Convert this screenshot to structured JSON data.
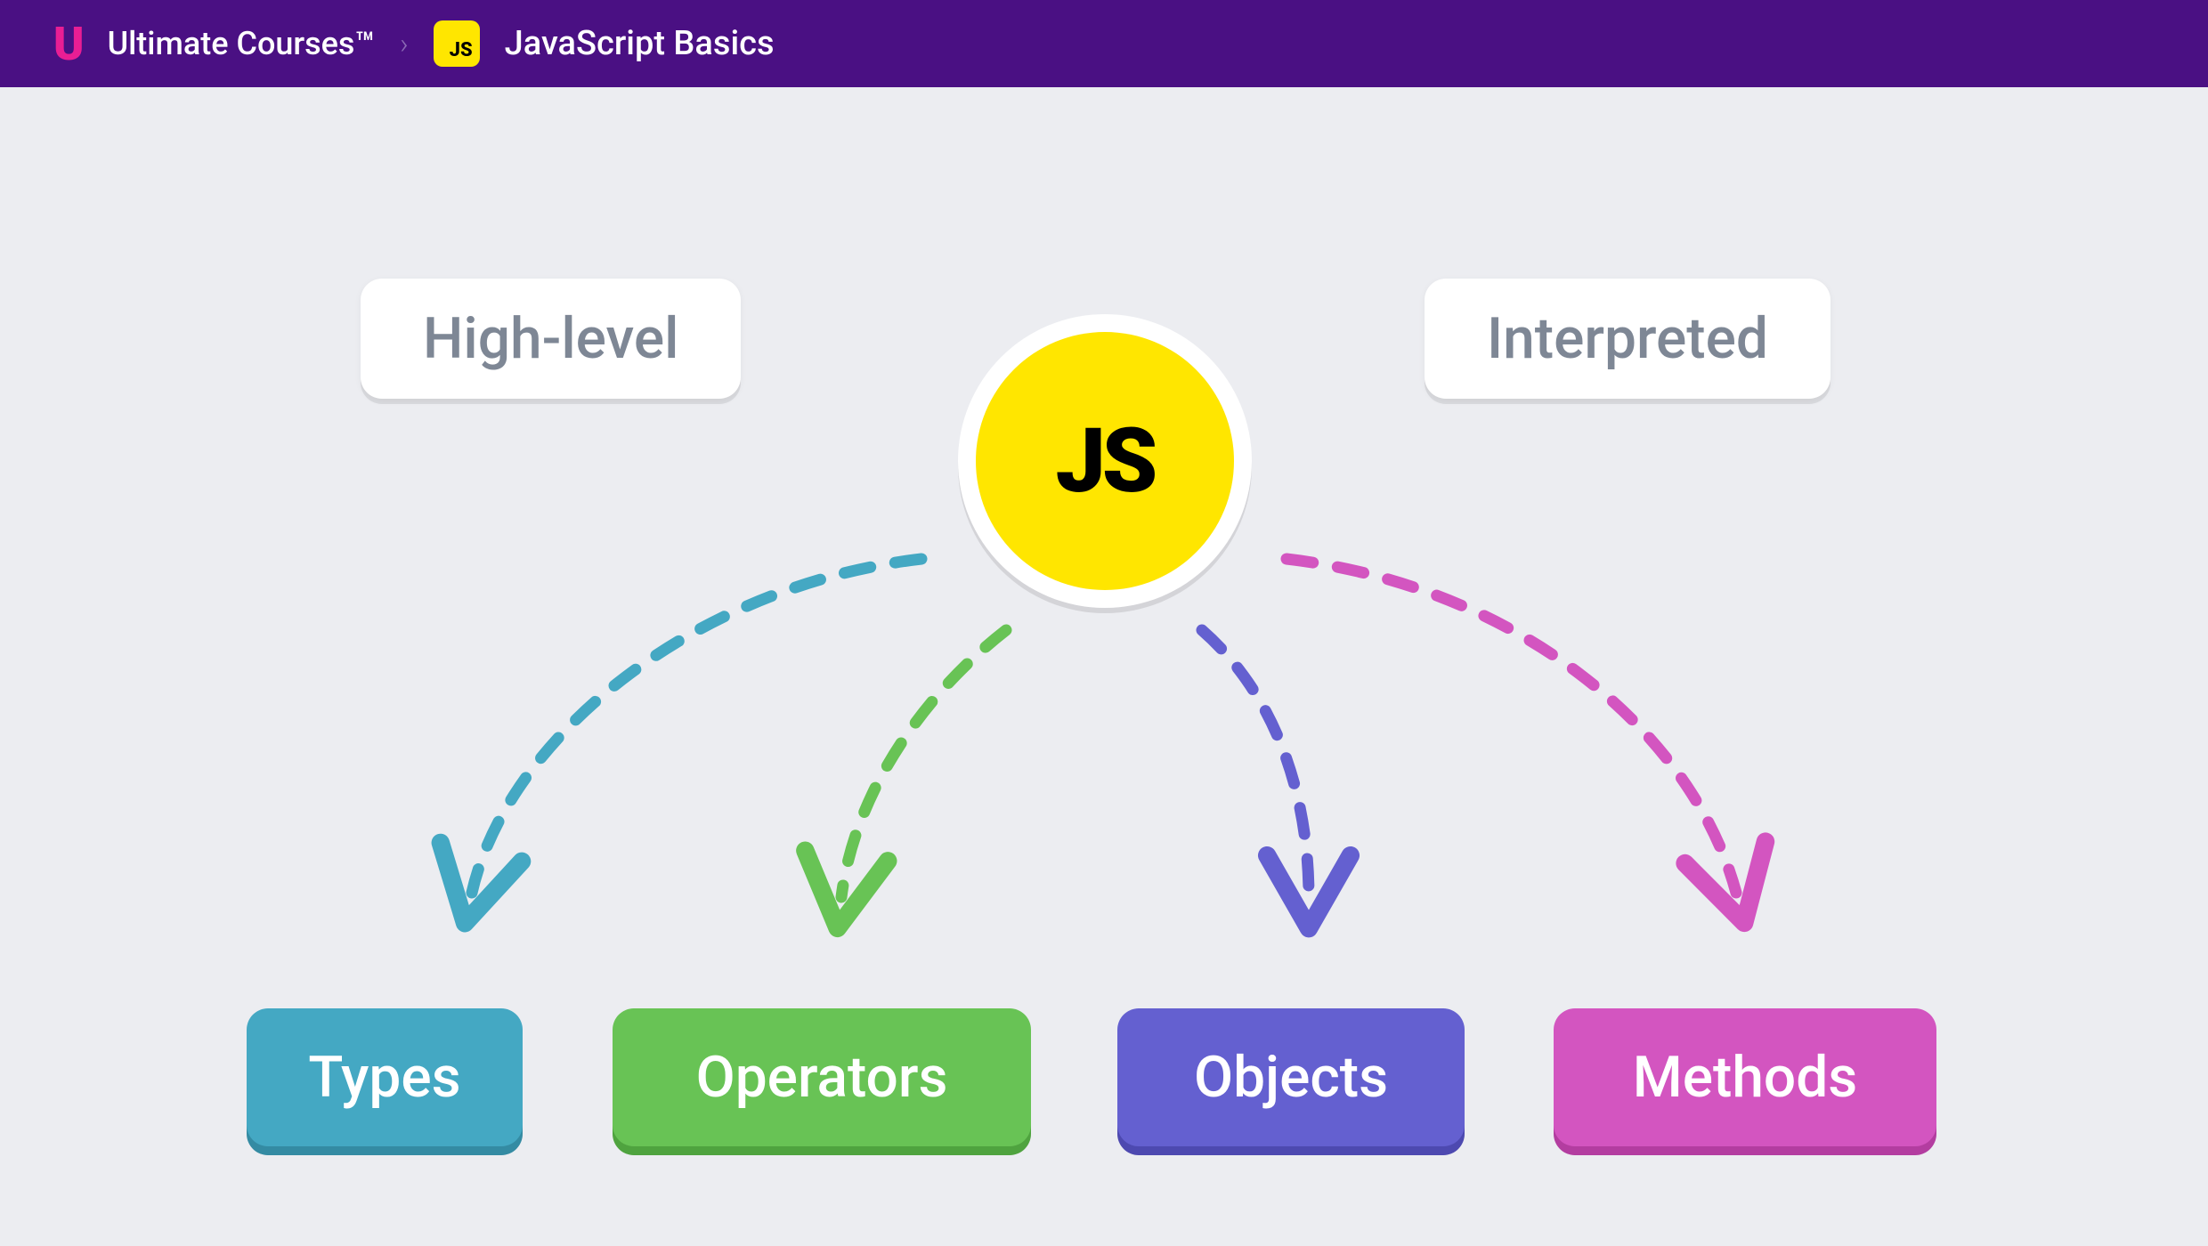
{
  "header": {
    "brand": "Ultimate Courses™",
    "js_badge": "JS",
    "course_title": "JavaScript Basics"
  },
  "diagram": {
    "trait_left": "High-level",
    "trait_right": "Interpreted",
    "center_label": "JS",
    "concepts": {
      "types": "Types",
      "operators": "Operators",
      "objects": "Objects",
      "methods": "Methods"
    },
    "arrow_colors": {
      "types": "#44a8c3",
      "operators": "#68c355",
      "objects": "#6460d0",
      "methods": "#d355c0"
    }
  }
}
